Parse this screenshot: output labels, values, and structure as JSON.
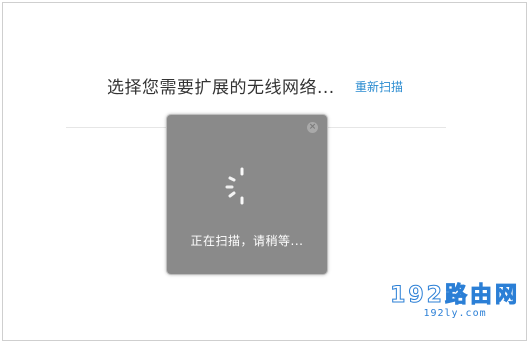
{
  "page": {
    "heading": "选择您需要扩展的无线网络...",
    "rescan_label": "重新扫描"
  },
  "modal": {
    "loading_text": "正在扫描，请稍等...",
    "close_icon": "close-icon"
  },
  "watermark": {
    "main": "192路由网",
    "sub": "192ly.com"
  },
  "colors": {
    "link": "#2a8bd0",
    "modal_bg": "#8a8a8a",
    "watermark": "#2b7fd6"
  }
}
